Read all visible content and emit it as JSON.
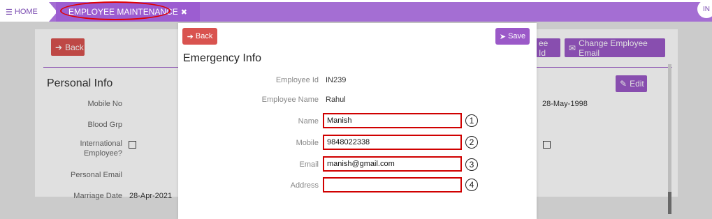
{
  "nav": {
    "home_label": "HOME",
    "active_tab_label": "EMPLOYEE MAINTENANCE",
    "avatar_initials": "IN"
  },
  "background": {
    "back_label": "Back",
    "employee_id_button_label": "ee Id",
    "change_email_label": "Change Employee Email",
    "section_title": "Personal Info",
    "edit_label": "Edit",
    "fields": {
      "mobile_no": "Mobile No",
      "blood_grp": "Blood Grp",
      "international_line1": "International",
      "international_line2": "Employee?",
      "personal_email": "Personal Email",
      "marriage_date": "Marriage Date",
      "marriage_date_value": "28-Apr-2021",
      "dob_value": "28-May-1998"
    }
  },
  "modal": {
    "back_label": "Back",
    "save_label": "Save",
    "title": "Emergency Info",
    "employee_id_label": "Employee Id",
    "employee_id_value": "IN239",
    "employee_name_label": "Employee Name",
    "employee_name_value": "Rahul",
    "name_label": "Name",
    "name_value": "Manish",
    "mobile_label": "Mobile",
    "mobile_value": "9848022338",
    "email_label": "Email",
    "email_value": "manish@gmail.com",
    "address_label": "Address",
    "address_value": "",
    "markers": [
      "1",
      "2",
      "3",
      "4"
    ]
  },
  "colors": {
    "brand_purple": "#a46ed3",
    "danger_red": "#d9534f",
    "annotation_red": "#d00000"
  }
}
